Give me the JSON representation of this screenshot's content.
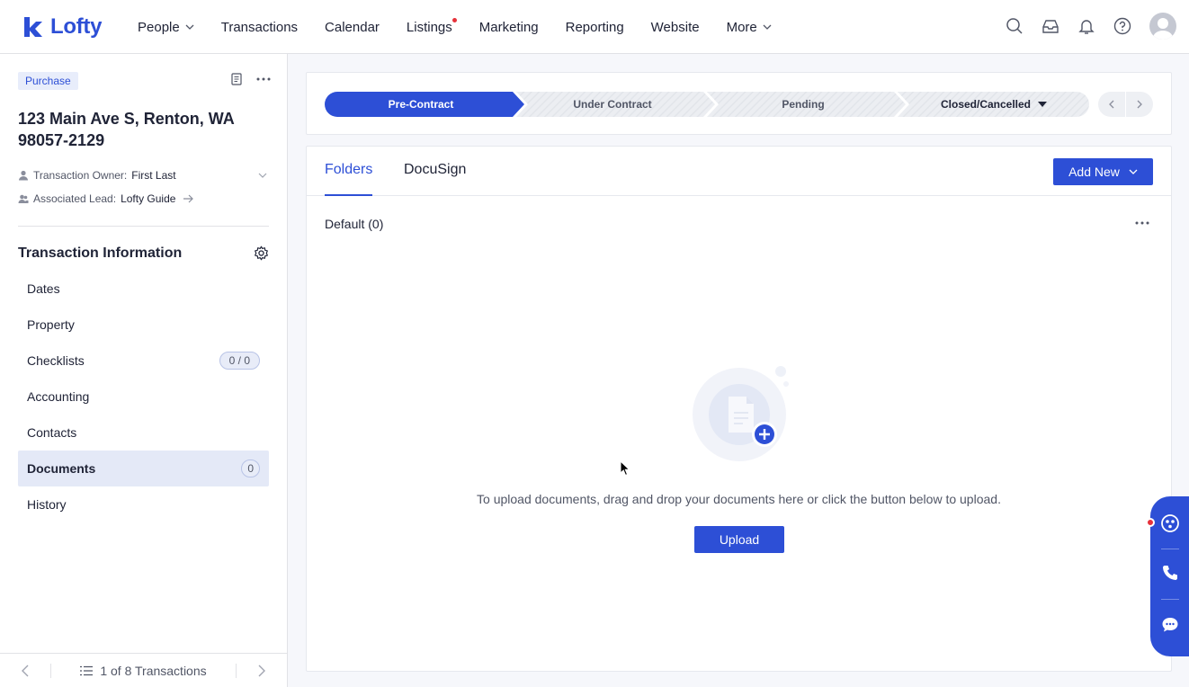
{
  "brand": {
    "name": "Lofty",
    "color": "#2d4fd6"
  },
  "nav": {
    "items": [
      {
        "label": "People",
        "dropdown": true,
        "dot": false
      },
      {
        "label": "Transactions",
        "dropdown": false,
        "dot": false
      },
      {
        "label": "Calendar",
        "dropdown": false,
        "dot": false
      },
      {
        "label": "Listings",
        "dropdown": false,
        "dot": true
      },
      {
        "label": "Marketing",
        "dropdown": false,
        "dot": false
      },
      {
        "label": "Reporting",
        "dropdown": false,
        "dot": false
      },
      {
        "label": "Website",
        "dropdown": false,
        "dot": false
      },
      {
        "label": "More",
        "dropdown": true,
        "dot": false
      }
    ],
    "icons": [
      "search-icon",
      "inbox-icon",
      "bell-icon",
      "help-icon",
      "avatar"
    ]
  },
  "transaction": {
    "type_tag": "Purchase",
    "address": "123 Main Ave S, Renton, WA 98057-2129",
    "owner_label": "Transaction Owner:",
    "owner_value": "First Last",
    "lead_label": "Associated Lead:",
    "lead_value": "Lofty Guide"
  },
  "sidebar": {
    "section_title": "Transaction Information",
    "items": [
      {
        "label": "Dates",
        "badge": null,
        "active": false
      },
      {
        "label": "Property",
        "badge": null,
        "active": false
      },
      {
        "label": "Checklists",
        "badge": "0 / 0",
        "active": false
      },
      {
        "label": "Accounting",
        "badge": null,
        "active": false
      },
      {
        "label": "Contacts",
        "badge": null,
        "active": false
      },
      {
        "label": "Documents",
        "badge": "0",
        "active": true
      },
      {
        "label": "History",
        "badge": null,
        "active": false
      }
    ],
    "pager_text": "1 of 8 Transactions"
  },
  "stages": [
    {
      "label": "Pre-Contract",
      "active": true,
      "dropdown": false
    },
    {
      "label": "Under Contract",
      "active": false,
      "dropdown": false
    },
    {
      "label": "Pending",
      "active": false,
      "dropdown": false
    },
    {
      "label": "Closed/Cancelled",
      "active": false,
      "dropdown": true
    }
  ],
  "documents": {
    "tabs": [
      {
        "label": "Folders",
        "active": true
      },
      {
        "label": "DocuSign",
        "active": false
      }
    ],
    "add_new_label": "Add New",
    "folder_label": "Default (0)",
    "empty_text": "To upload documents, drag and drop your documents here or click the button below to upload.",
    "upload_label": "Upload"
  },
  "dock": {
    "icons": [
      "assistant-icon",
      "phone-icon",
      "chat-icon"
    ]
  }
}
